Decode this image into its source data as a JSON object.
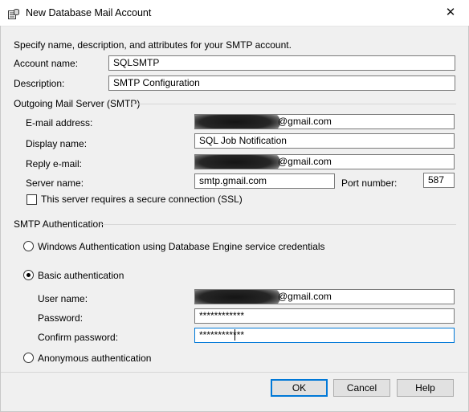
{
  "window": {
    "title": "New Database Mail Account",
    "close_glyph": "✕"
  },
  "intro": "Specify name, description, and attributes for your SMTP account.",
  "account": {
    "name_label": "Account name:",
    "name_value": "SQLSMTP",
    "description_label": "Description:",
    "description_value": "SMTP Configuration"
  },
  "outgoing": {
    "section_label": "Outgoing Mail Server (SMTP)",
    "email_label": "E-mail address:",
    "email_value": "@gmail.com",
    "display_label": "Display name:",
    "display_value": "SQL Job Notification",
    "reply_label": "Reply e-mail:",
    "reply_value": "@gmail.com",
    "server_label": "Server name:",
    "server_value": "smtp.gmail.com",
    "port_label": "Port number:",
    "port_value": "587",
    "ssl_label": "This server requires a secure connection (SSL)",
    "ssl_checked": false
  },
  "auth": {
    "section_label": "SMTP Authentication",
    "windows_label": "Windows Authentication using Database Engine service credentials",
    "basic_label": "Basic authentication",
    "username_label": "User name:",
    "username_value": "@gmail.com",
    "password_label": "Password:",
    "password_value": "************",
    "confirm_label": "Confirm password:",
    "confirm_value": "************",
    "anonymous_label": "Anonymous authentication",
    "selected": "basic"
  },
  "buttons": {
    "ok": "OK",
    "cancel": "Cancel",
    "help": "Help"
  }
}
